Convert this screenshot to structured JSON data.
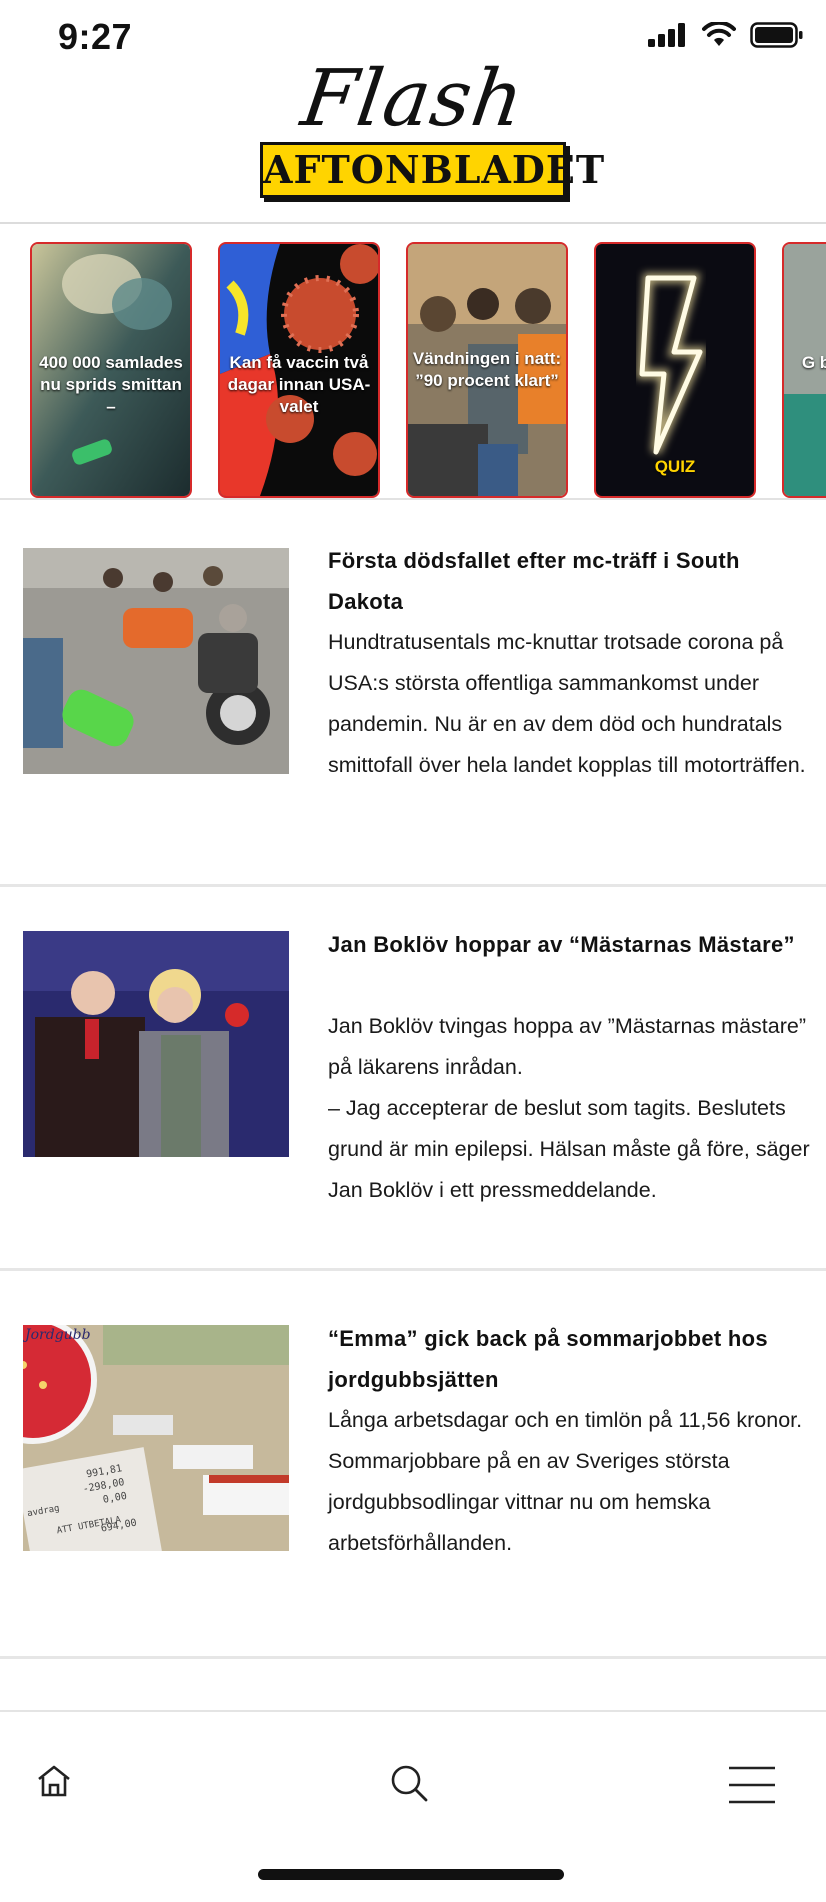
{
  "status": {
    "time": "9:27"
  },
  "header": {
    "logo_script": "Flash",
    "logo_brand": "AFTONBLADET",
    "brand_color": "#ffd400"
  },
  "stories": [
    {
      "caption": "400 000 samlades nu sprids smittan –"
    },
    {
      "caption": "Kan få vaccin två dagar innan USA-valet"
    },
    {
      "caption": "Vändningen i natt: ”90 procent klart”"
    },
    {
      "caption": "QUIZ"
    },
    {
      "caption": "G b"
    }
  ],
  "articles": [
    {
      "title": "Första dödsfallet efter mc-träff i South Dakota",
      "body": "Hundtratusentals mc-knuttar trotsade corona på USA:s största offentliga sammankomst under pandemin. Nu är en av dem död och hundratals smittofall över hela landet kopplas till motorträffen."
    },
    {
      "title": "Jan Boklöv hoppar av “Mästarnas Mästare”",
      "body_lines": [
        "Jan Boklöv tvingas hoppa av ”Mästarnas mästare” på läkarens inrådan.",
        "– Jag accepterar de beslut som tagits. Beslutets grund är min epilepsi. Hälsan måste gå före, säger Jan Boklöv i ett pressmeddelande."
      ]
    },
    {
      "title": "“Emma” gick back på sommarjobbet hos jordgubbsjätten",
      "body": "Långa arbetsdagar och en timlön på 11,56 kronor. Sommarjobbare på en av Sveriges största jordgubbsodlingar vittnar nu om hemska arbetsförhållanden.",
      "receipt": {
        "line1": "991,81",
        "line2": "-298,00",
        "line3": "0,00",
        "label_left": "avdrag",
        "label_total": "ATT UTBETALA",
        "total": "694,00",
        "header_word": "Jordgubb"
      }
    }
  ],
  "tab_bar": {
    "home": "home-icon",
    "search": "search-icon",
    "menu": "menu-icon"
  }
}
